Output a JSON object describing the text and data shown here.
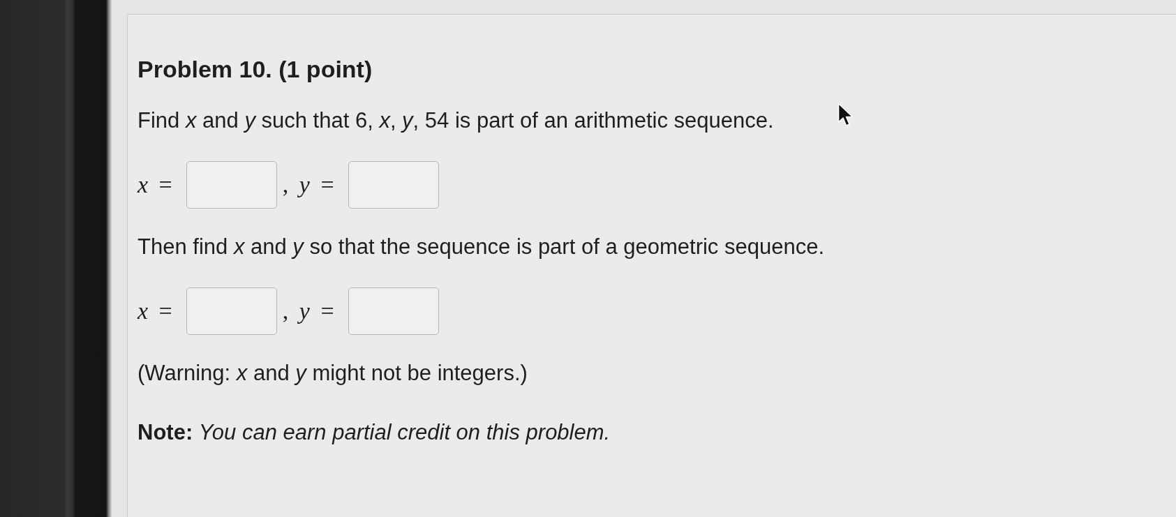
{
  "problem": {
    "title": "Problem 10. (1 point)",
    "blocks": [
      {
        "kind": "text",
        "text": "Find *x* and *y* such that 6, *x*, *y*, 54 is part of an arithmetic sequence."
      },
      {
        "kind": "answers",
        "fields": [
          {
            "label": "*x* ="
          },
          {
            "label": ", *y* ="
          }
        ]
      },
      {
        "kind": "text",
        "text": "Then find *x* and *y* so that the sequence is part of a geometric sequence."
      },
      {
        "kind": "answers",
        "fields": [
          {
            "label": "*x* ="
          },
          {
            "label": ", *y* ="
          }
        ]
      },
      {
        "kind": "text",
        "text": "(Warning: *x* and *y* might not be integers.)"
      },
      {
        "kind": "note",
        "text": "**Note:** *You can earn partial credit on this problem.*"
      }
    ]
  }
}
